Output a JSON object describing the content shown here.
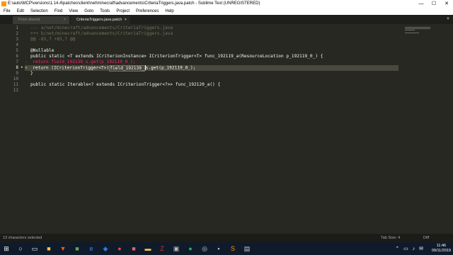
{
  "window": {
    "title": "E:\\auto\\MCP\\versions\\1.14.4\\patches\\client\\net\\minecraft\\advancements\\CriteriaTriggers.java.patch - Sublime Text (UNREGISTERED)",
    "minimize": "—",
    "maximize": "☐",
    "close": "✕"
  },
  "menu": [
    "File",
    "Edit",
    "Selection",
    "Find",
    "View",
    "Goto",
    "Tools",
    "Project",
    "Preferences",
    "Help"
  ],
  "tabs": [
    {
      "label": "From diverst",
      "close": "×"
    },
    {
      "label": "CriteriaTriggers.java.patch",
      "close": "×"
    }
  ],
  "tab_scroll": "▼",
  "line_numbers": [
    "1",
    "2",
    "3",
    "4",
    "5",
    "6",
    "7",
    "8",
    "9",
    "10",
    "11",
    "12"
  ],
  "active_line_index": 7,
  "code": {
    "l1": "--- a/net/minecraft/advancements/CriteriaTriggers.java",
    "l2": "+++ b/net/minecraft/advancements/CriteriaTriggers.java",
    "l3": "@@ -85,7 +85,7 @@",
    "l5_annot": "@Nullable",
    "l6_a": "public static <T extends ICriterionInstance> ICriterionTrigger<T> func_192119_a(",
    "l6_b": "ResourceLocation p_192119_0_",
    "l6_c": ") {",
    "l7_minus": "-",
    "l7": "return field_192139_s.get(p_192119_0_);",
    "l8_plus": "+",
    "l8_a": "return (ICriterionTrigger<T>)",
    "l8_sel": "field_192139_",
    "l8_b": "s.get(p_192119_0_);",
    "l9": "}",
    "l11": "public static Iterable<? extends ICriterionTrigger<?>> func_192120_a() {"
  },
  "status": {
    "left": "13 characters selected",
    "tab_size": "Tab Size: 4",
    "syntax": "Diff"
  },
  "taskbar": {
    "icons": [
      "windows-icon",
      "search-icon",
      "task-view-icon",
      "explorer-icon",
      "brave-icon",
      "minecraft-icon",
      "edge-icon",
      "vscode-icon",
      "chrome-icon",
      "filezilla-icon",
      "folder-icon",
      "app-icon",
      "spotify-icon",
      "steam-icon",
      "terminal-icon",
      "sublime-icon",
      "notepad-icon"
    ],
    "time": "11:46",
    "date": "09/11/2019"
  }
}
